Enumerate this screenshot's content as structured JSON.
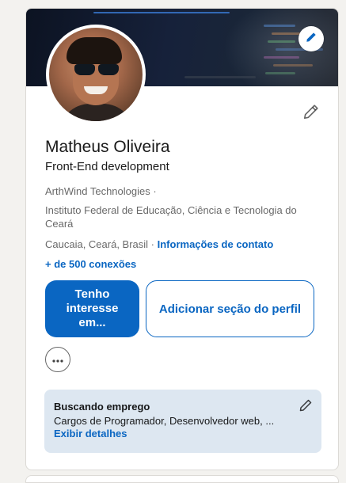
{
  "profile": {
    "name": "Matheus Oliveira",
    "headline": "Front-End development",
    "company": "ArthWind Technologies ·",
    "education": "Instituto Federal de Educação, Ciência e Tecnologia do Ceará",
    "location": "Caucaia, Ceará, Brasil ·",
    "contact_link": "Informações de contato",
    "connections": "+ de 500 conexões"
  },
  "actions": {
    "primary_label": "Tenho interesse em...",
    "secondary_label": "Adicionar seção do perfil"
  },
  "job_seeking": {
    "title": "Buscando emprego",
    "description": "Cargos de Programador, Desenvolvedor web, ...",
    "details_link": "Exibir detalhes"
  },
  "icons": {
    "cover_edit": "pencil-icon",
    "profile_edit": "pencil-icon",
    "more": "ellipsis-icon",
    "job_edit": "pencil-icon"
  },
  "colors": {
    "accent": "#0a66c2",
    "job_box_bg": "#dde7f1",
    "page_bg": "#f3f2ef"
  }
}
